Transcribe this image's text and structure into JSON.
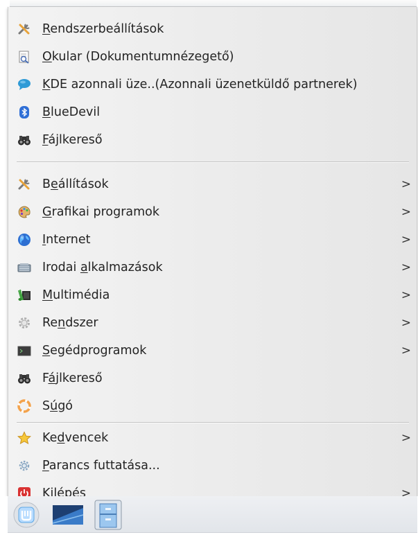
{
  "menu": {
    "favorites": [
      {
        "icon": "tools-icon",
        "pre": "",
        "acc": "R",
        "post": "endszerbeállítások"
      },
      {
        "icon": "okular-icon",
        "pre": "",
        "acc": "O",
        "post": "kular (Dokumentumnézegető)"
      },
      {
        "icon": "chat-bubble-icon",
        "pre": "",
        "acc": "K",
        "post": "DE azonnali üze..(Azonnali üzenetküldő partnerek)"
      },
      {
        "icon": "bluetooth-icon",
        "pre": "",
        "acc": "B",
        "post": "lueDevil"
      },
      {
        "icon": "binoculars-icon",
        "pre": "",
        "acc": "F",
        "post": "ájlkereső"
      }
    ],
    "categories": [
      {
        "icon": "tools-icon",
        "pre": "B",
        "acc": "e",
        "post": "állítások",
        "arrow": ">"
      },
      {
        "icon": "palette-icon",
        "pre": "",
        "acc": "G",
        "post": "rafikai programok",
        "arrow": ">"
      },
      {
        "icon": "globe-icon",
        "pre": "",
        "acc": "I",
        "post": "nternet",
        "arrow": ">"
      },
      {
        "icon": "office-icon",
        "pre": "Irodai ",
        "acc": "a",
        "post": "lkalmazások",
        "arrow": ">"
      },
      {
        "icon": "multimedia-icon",
        "pre": "",
        "acc": "M",
        "post": "ultimédia",
        "arrow": ">"
      },
      {
        "icon": "system-gear-icon",
        "pre": "Re",
        "acc": "n",
        "post": "dszer",
        "arrow": ">"
      },
      {
        "icon": "terminal-icon",
        "pre": "",
        "acc": "S",
        "post": "egédprogramok",
        "arrow": ">"
      },
      {
        "icon": "binoculars-icon",
        "pre": "F",
        "acc": "á",
        "post": "jlkereső",
        "arrow": ""
      },
      {
        "icon": "lifebuoy-icon",
        "pre": "S",
        "acc": "ú",
        "post": "gó",
        "arrow": ""
      }
    ],
    "footer": [
      {
        "icon": "star-icon",
        "pre": "Ke",
        "acc": "d",
        "post": "vencek",
        "arrow": ">"
      },
      {
        "icon": "run-gear-icon",
        "pre": "",
        "acc": "P",
        "post": "arancs futtatása...",
        "arrow": ""
      },
      {
        "icon": "power-icon",
        "pre": "Ki",
        "acc": "l",
        "post": "épés",
        "arrow": ">"
      }
    ]
  },
  "panel": {
    "items": [
      "app-launcher-icon",
      "desktop-icon",
      "file-manager-icon"
    ]
  }
}
